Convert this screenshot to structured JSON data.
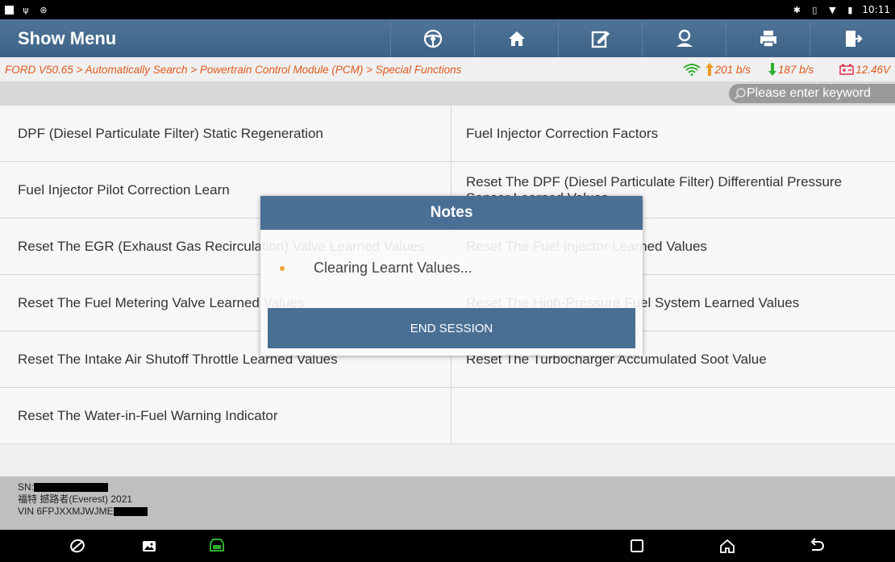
{
  "statusbar": {
    "time": "10:11"
  },
  "app": {
    "title": "Show Menu"
  },
  "toolbar": [
    "steering-wheel-icon",
    "home-icon",
    "edit-icon",
    "user-icon",
    "print-icon",
    "exit-icon"
  ],
  "breadcrumb": "FORD V50.65 > Automatically Search > Powertrain Control Module (PCM) > Special Functions",
  "rates": {
    "up": "201 b/s",
    "down": "187 b/s",
    "voltage": "12.46V"
  },
  "search": {
    "placeholder": "Please enter keyword"
  },
  "menu": {
    "rows": [
      [
        "DPF (Diesel Particulate Filter) Static Regeneration",
        "Fuel Injector Correction Factors"
      ],
      [
        "Fuel Injector Pilot Correction Learn",
        "Reset The DPF (Diesel Particulate Filter) Differential Pressure Sensor Learned Values"
      ],
      [
        "Reset The EGR (Exhaust Gas Recirculation) Valve Learned Values",
        "Reset The Fuel Injector Learned Values"
      ],
      [
        "Reset The Fuel Metering Valve Learned Values",
        "Reset The High-Pressure Fuel System Learned Values"
      ],
      [
        "Reset The Intake Air Shutoff Throttle Learned Values",
        "Reset The Turbocharger Accumulated Soot Value"
      ],
      [
        "Reset The Water-in-Fuel Warning Indicator",
        ""
      ]
    ]
  },
  "footer": {
    "sn_label": "SN:",
    "vehicle": "福特 撼路者(Everest) 2021",
    "vin_label": "VIN 6FPJXXMJWJME"
  },
  "dialog": {
    "title": "Notes",
    "message": "Clearing Learnt Values...",
    "button": "END SESSION"
  },
  "colors": {
    "header": "#3f6589",
    "accent": "#e05a1c",
    "green": "#2fae2f",
    "red": "#e0304a"
  }
}
